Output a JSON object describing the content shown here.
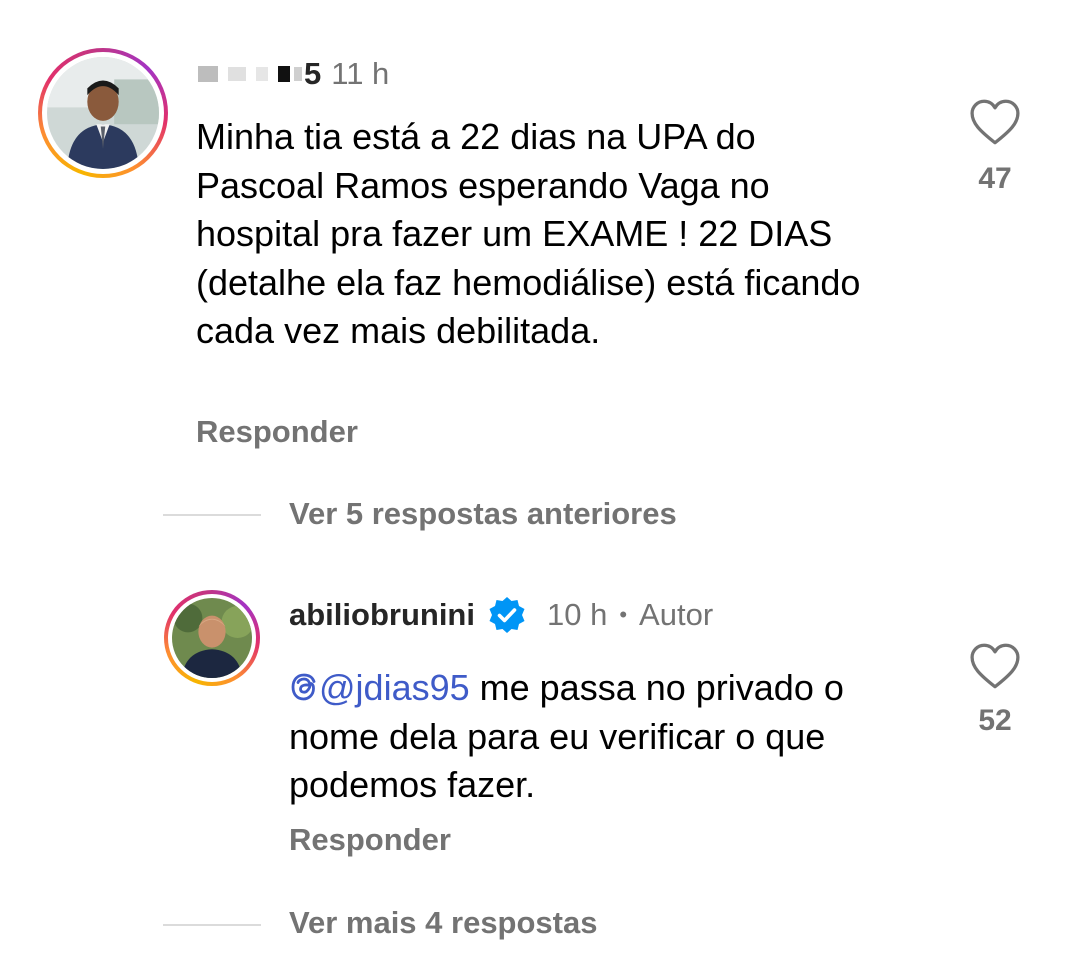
{
  "comments": [
    {
      "username_visible_fragment": "5",
      "time": "11 h",
      "text": "Minha tia está a 22 dias na UPA do Pascoal Ramos esperando Vaga no hospital pra fazer um EXAME ! 22 DIAS (detalhe ela faz hemodiálise) está ficando  cada vez mais debilitada.",
      "reply_label": "Responder",
      "likes": "47"
    },
    {
      "username": "abiliobrunini",
      "verified": true,
      "time": "10 h",
      "separator": "•",
      "author_badge": "Autor",
      "mention": "@jdias95",
      "text": " me passa no privado o nome dela para eu verificar o que podemos fazer.",
      "reply_label": "Responder",
      "likes": "52"
    }
  ],
  "threads": {
    "previous_replies": "Ver 5 respostas anteriores",
    "more_replies": "Ver mais 4 respostas"
  },
  "colors": {
    "secondary_text": "#737373",
    "mention": "#3f5bc8",
    "verified_badge": "#0095f6",
    "divider": "#dbdbdb"
  },
  "icons": {
    "like": "heart-outline-icon",
    "verified": "verified-badge-icon",
    "threads": "threads-logo-icon"
  }
}
